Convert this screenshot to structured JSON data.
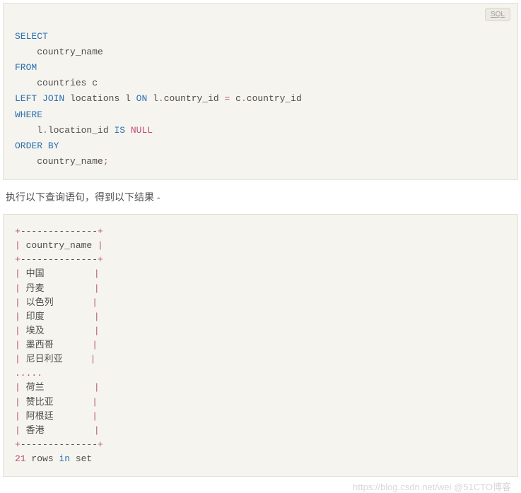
{
  "sql_block": {
    "lang_badge": "SQL",
    "lines": {
      "l1_kw": "SELECT",
      "l2": "    country_name",
      "l3_kw": "FROM",
      "l4": "    countries c",
      "l5_kw1": "LEFT",
      "l5_kw2": "JOIN",
      "l5_a": " locations l ",
      "l5_kw3": "ON",
      "l5_b": " l",
      "l5_op1": ".",
      "l5_c": "country_id ",
      "l5_op2": "=",
      "l5_d": " c",
      "l5_op3": ".",
      "l5_e": "country_id",
      "l6_kw": "WHERE",
      "l7_a": "    l",
      "l7_op1": ".",
      "l7_b": "location_id ",
      "l7_kw": "IS",
      "l7_sp": " ",
      "l7_null": "NULL",
      "l8_kw1": "ORDER",
      "l8_sp": " ",
      "l8_kw2": "BY",
      "l9_a": "    country_name",
      "l9_op": ";"
    }
  },
  "paragraph": "执行以下查询语句，得到以下结果 -",
  "result": {
    "border_top": {
      "plus1": "+",
      "dash": "--------------",
      "plus2": "+"
    },
    "header": {
      "p1": "|",
      "t": " country_name ",
      "p2": "|"
    },
    "border_mid": {
      "plus1": "+",
      "dash": "--------------",
      "plus2": "+"
    },
    "rows": [
      " 中国         ",
      " 丹麦         ",
      " 以色列       ",
      " 印度         ",
      " 埃及         ",
      " 墨西哥       ",
      " 尼日利亚     "
    ],
    "ellipsis": ".....",
    "rows2": [
      " 荷兰         ",
      " 赞比亚       ",
      " 阿根廷       ",
      " 香港         "
    ],
    "border_bot": {
      "plus1": "+",
      "dash": "--------------",
      "plus2": "+"
    },
    "footer": {
      "num": "21",
      "a": " rows ",
      "kw": "in",
      "b": " set"
    }
  },
  "watermark": "https://blog.csdn.net/wei   @51CTO博客"
}
